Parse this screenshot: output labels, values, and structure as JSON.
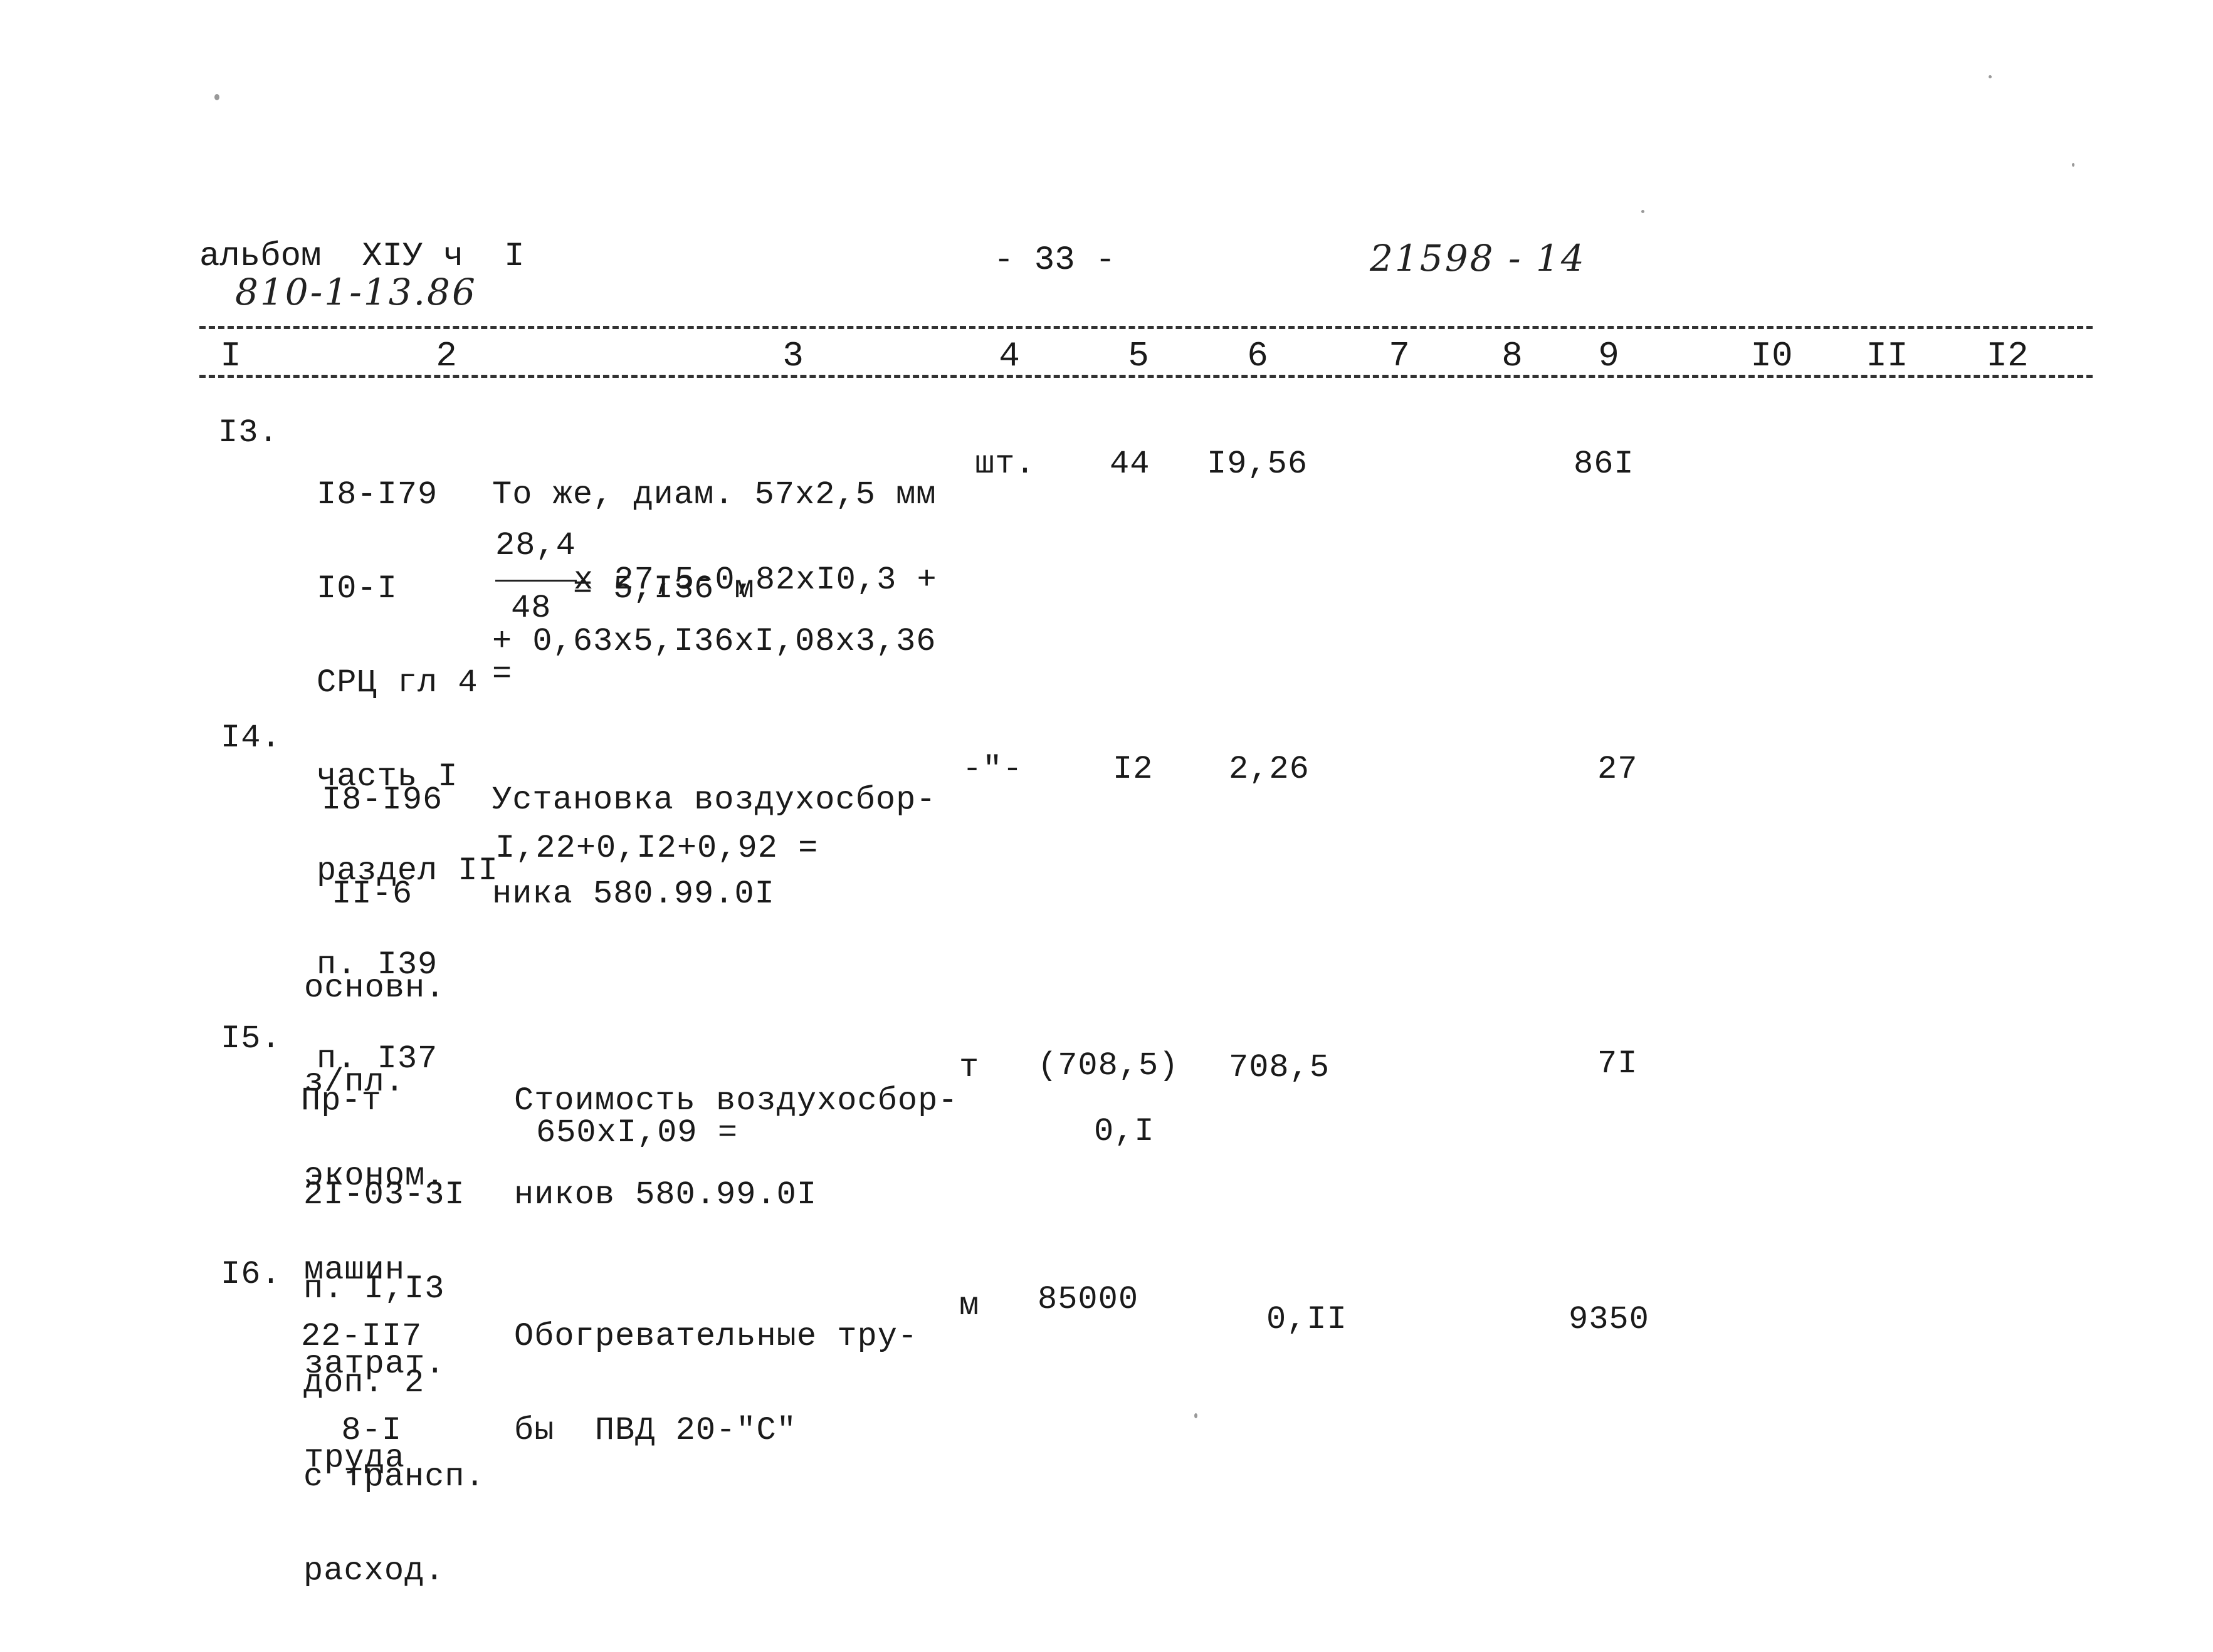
{
  "header": {
    "album_label": "альбом  ХIУ ч  I",
    "album_code_handwritten": "810-1-13.86",
    "page_number": "- 33 -",
    "doc_number_handwritten": "21598 - 14"
  },
  "columns": [
    "I",
    "2",
    "3",
    "4",
    "5",
    "6",
    "7",
    "8",
    "9",
    "I0",
    "II",
    "I2"
  ],
  "rows": [
    {
      "num": "I3.",
      "code_lines": [
        "I8-I79",
        "I0-I",
        "СРЦ гл 4",
        "часть I",
        "раздел II",
        "п. I39",
        "п. I37"
      ],
      "desc_lines": [
        "То же, диам. 57х2,5 мм",
        "    = 5,I36 м"
      ],
      "calc": {
        "numerator": "28,4",
        "denominator": "48",
        "after_bar": "х 27,5-0,82хI0,3 +",
        "line2": "+ 0,63х5,I36хI,08х3,36",
        "line3": "="
      },
      "unit": "шт.",
      "qty": "44",
      "price": "I9,56",
      "col7": "",
      "col8": "",
      "total": "86I",
      "col10": "",
      "col11": "",
      "col12": ""
    },
    {
      "num": "I4.",
      "code_lines": [
        "I8-I96",
        " II-6",
        "основн.",
        "з/пл.",
        "эконом.",
        "машин",
        "затрат.",
        "труда"
      ],
      "desc_lines": [
        "Установка воздухосбор-",
        "ника 580.99.0I"
      ],
      "calc_line": "I,22+0,I2+0,92 =",
      "unit": "-\"-",
      "qty": "I2",
      "price": "2,26",
      "col7": "",
      "col8": "",
      "total": "27",
      "col10": "",
      "col11": "",
      "col12": ""
    },
    {
      "num": "I5.",
      "code_lines": [
        "Пр-т",
        "2I-03-3I",
        "п. I,I3",
        "доп. 2",
        "с трансп.",
        "расход."
      ],
      "desc_lines": [
        "Стоимость воздухосбор-",
        "ников 580.99.0I"
      ],
      "calc_line": "650хI,09 =",
      "unit": "т",
      "qty": "(708,5)",
      "qty_sub": "0,I",
      "price": "708,5",
      "col7": "",
      "col8": "",
      "total": "7I",
      "col10": "",
      "col11": "",
      "col12": ""
    },
    {
      "num": "I6.",
      "code_lines": [
        "22-II7",
        "  8-I"
      ],
      "desc_lines": [
        "Обогревательные тру-",
        "бы  ПВД 20-\"С\""
      ],
      "unit": "м",
      "qty": "85000",
      "price": "0,II",
      "col7": "",
      "col8": "",
      "total": "9350",
      "col10": "",
      "col11": "",
      "col12": ""
    }
  ]
}
